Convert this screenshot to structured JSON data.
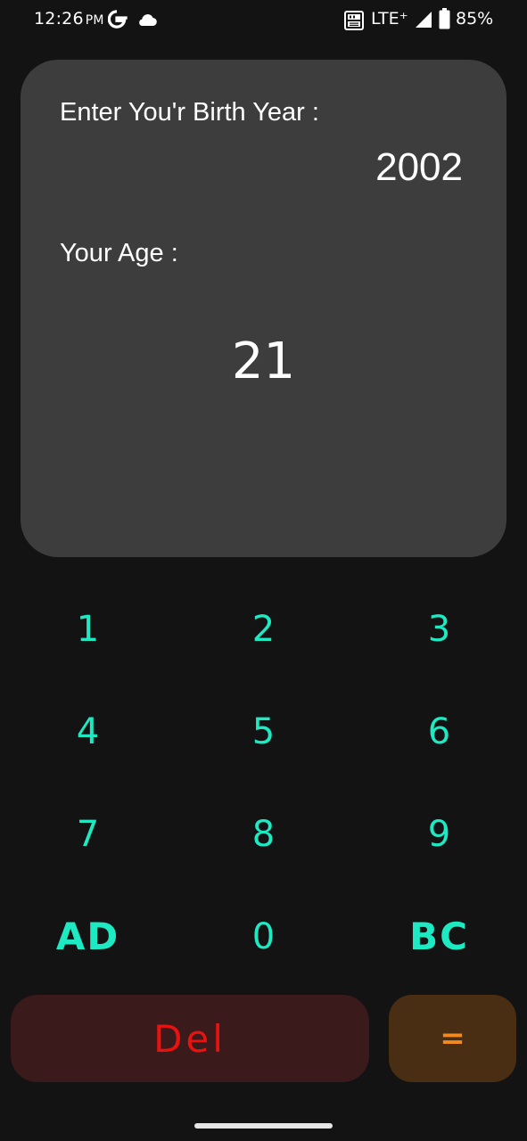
{
  "status_bar": {
    "time": "12:26",
    "ampm": "PM",
    "network": "LTE⁺",
    "battery": "85%",
    "battery_level": 0.85,
    "icons": [
      "google-g-icon",
      "cloud-icon",
      "volte-icon",
      "signal-icon",
      "battery-icon"
    ]
  },
  "display": {
    "birth_label": "Enter You'r Birth Year :",
    "birth_value": "2002",
    "age_label": "Your Age :",
    "age_value": "21"
  },
  "keypad": {
    "keys": [
      "1",
      "2",
      "3",
      "4",
      "5",
      "6",
      "7",
      "8",
      "9",
      "AD",
      "0",
      "BC"
    ]
  },
  "actions": {
    "del_label": "Del",
    "equals_label": "="
  },
  "colors": {
    "background": "#131313",
    "card": "#3d3d3d",
    "key_text": "#1de9c2",
    "del_text": "#e8120f",
    "del_bg": "#3a1a1b",
    "equals_text": "#f28a1e",
    "equals_bg": "#4a2e14"
  }
}
